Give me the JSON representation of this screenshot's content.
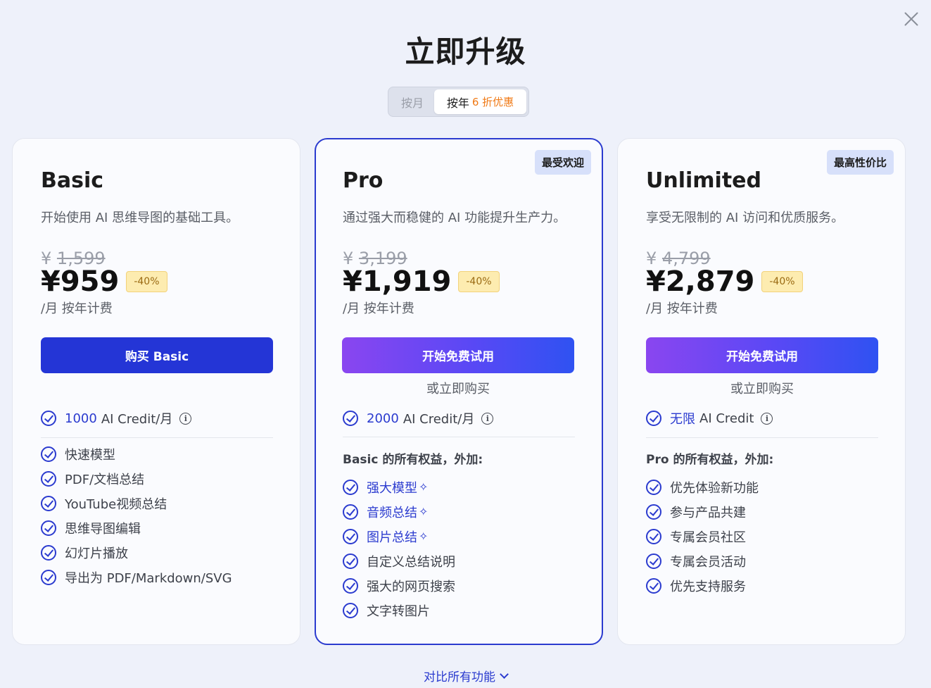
{
  "title": "立即升级",
  "billing_toggle": {
    "monthly": "按月",
    "yearly": "按年",
    "yearly_promo": "6 折优惠",
    "selected": "yearly"
  },
  "plans": [
    {
      "name": "Basic",
      "description": "开始使用 AI 思维导图的基础工具。",
      "currency": "¥",
      "original_price": "1,599",
      "price": "¥959",
      "discount": "-40%",
      "per": "/月 按年计费",
      "cta": "购买 Basic",
      "credit_highlight": "1000",
      "credit_text": "AI Credit/月",
      "features": [
        "快速模型",
        "PDF/文档总结",
        "YouTube视频总结",
        "思维导图编辑",
        "幻灯片播放",
        "导出为 PDF/Markdown/SVG"
      ]
    },
    {
      "name": "Pro",
      "badge": "最受欢迎",
      "description": "通过强大而稳健的 AI 功能提升生产力。",
      "currency": "¥",
      "original_price": "3,199",
      "price": "¥1,919",
      "discount": "-40%",
      "per": "/月 按年计费",
      "cta": "开始免费试用",
      "or_buy": "或立即购买",
      "credit_highlight": "2000",
      "credit_text": "AI Credit/月",
      "plus_title": "Basic 的所有权益，外加:",
      "features_highlight": [
        "强大模型",
        "音频总结",
        "图片总结"
      ],
      "features": [
        "自定义总结说明",
        "强大的网页搜索",
        "文字转图片"
      ]
    },
    {
      "name": "Unlimited",
      "badge": "最高性价比",
      "description": "享受无限制的 AI 访问和优质服务。",
      "currency": "¥",
      "original_price": "4,799",
      "price": "¥2,879",
      "discount": "-40%",
      "per": "/月 按年计费",
      "cta": "开始免费试用",
      "or_buy": "或立即购买",
      "credit_highlight": "无限",
      "credit_text": "AI Credit",
      "plus_title": "Pro 的所有权益，外加:",
      "features": [
        "优先体验新功能",
        "参与产品共建",
        "专属会员社区",
        "专属会员活动",
        "优先支持服务"
      ]
    }
  ],
  "compare_link": "对比所有功能",
  "icons": {
    "close": "close-icon",
    "check": "check-circle-icon",
    "info": "info-icon",
    "sparkle": "sparkle-icon",
    "chevron": "chevron-down-icon"
  },
  "colors": {
    "accent": "#2b3bcf",
    "promo": "#f07a16",
    "background": "#eef1fa"
  }
}
